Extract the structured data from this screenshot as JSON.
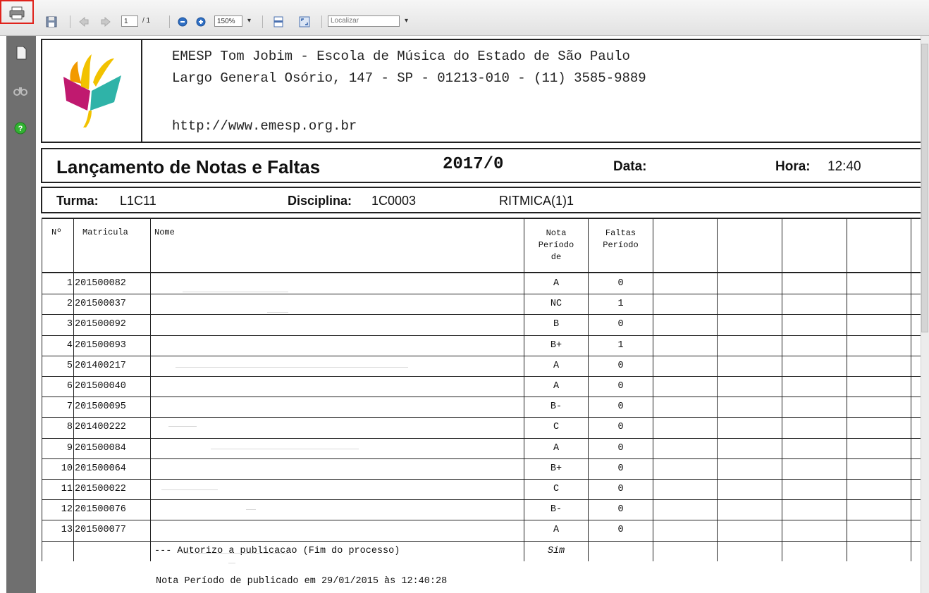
{
  "toolbar": {
    "page_current": "1",
    "page_total": "/ 1",
    "zoom": "150%",
    "search_placeholder": "Localizar"
  },
  "header": {
    "line1": "EMESP Tom Jobim - Escola de Música do Estado de São Paulo",
    "line2": "Largo General Osório, 147 - SP - 01213-010 - (11) 3585-9889",
    "line3": "http://www.emesp.org.br"
  },
  "report": {
    "title": "Lançamento de Notas e Faltas",
    "period": "2017/0",
    "date_label": "Data:",
    "hour_label": "Hora:",
    "hour_value": "12:40",
    "turma_label": "Turma:",
    "turma_value": "L1C11",
    "disciplina_label": "Disciplina:",
    "disciplina_value": "1C0003",
    "disciplina_name": "RITMICA(1)1"
  },
  "table": {
    "headers": {
      "num": "Nº",
      "matricula": "Matricula",
      "nome": "Nome",
      "nota": [
        "Nota",
        "Período",
        "de"
      ],
      "faltas": [
        "Faltas",
        "Período"
      ]
    },
    "rows": [
      {
        "n": "1",
        "matricula": "201500082",
        "nota": "A",
        "faltas": "0"
      },
      {
        "n": "2",
        "matricula": "201500037",
        "nota": "NC",
        "faltas": "1"
      },
      {
        "n": "3",
        "matricula": "201500092",
        "nota": "B",
        "faltas": "0"
      },
      {
        "n": "4",
        "matricula": "201500093",
        "nota": "B+",
        "faltas": "1"
      },
      {
        "n": "5",
        "matricula": "201400217",
        "nota": "A",
        "faltas": "0"
      },
      {
        "n": "6",
        "matricula": "201500040",
        "nota": "A",
        "faltas": "0"
      },
      {
        "n": "7",
        "matricula": "201500095",
        "nota": "B-",
        "faltas": "0"
      },
      {
        "n": "8",
        "matricula": "201400222",
        "nota": "C",
        "faltas": "0"
      },
      {
        "n": "9",
        "matricula": "201500084",
        "nota": "A",
        "faltas": "0"
      },
      {
        "n": "10",
        "matricula": "201500064",
        "nota": "B+",
        "faltas": "0"
      },
      {
        "n": "11",
        "matricula": "201500022",
        "nota": "C",
        "faltas": "0"
      },
      {
        "n": "12",
        "matricula": "201500076",
        "nota": "B-",
        "faltas": "0"
      },
      {
        "n": "13",
        "matricula": "201500077",
        "nota": "A",
        "faltas": "0"
      }
    ],
    "footer_row": {
      "text": "--- Autorizo a publicacao (Fim do processo)",
      "nota": "Sim"
    }
  },
  "published_note": "Nota Período de publicado em 29/01/2015 às 12:40:28",
  "colors": {
    "highlight": "#e0231c",
    "rail": "#6f6f6f"
  },
  "icons": [
    "print-icon",
    "save-icon",
    "prev-page-icon",
    "next-page-icon",
    "zoom-out-icon",
    "zoom-in-icon",
    "fit-width-icon",
    "fullscreen-icon",
    "dropdown-icon",
    "pages-panel-icon",
    "binoculars-icon",
    "help-icon"
  ]
}
